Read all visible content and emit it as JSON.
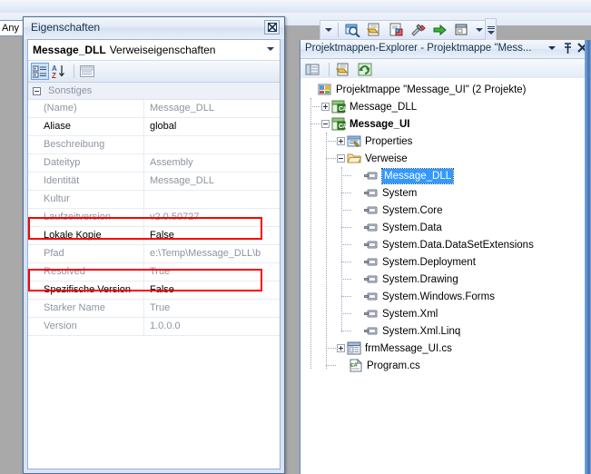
{
  "background": {
    "platform_combo_value": "Any",
    "toolbar_icons": [
      "search-folder-icon",
      "document-icon",
      "property-pages-icon",
      "tools-hammer-icon",
      "green-arrow-icon",
      "window-icon"
    ]
  },
  "properties_window": {
    "title": "Eigenschaften",
    "close_label": "Close",
    "object_name": "Message_DLL",
    "object_kind": "Verweiseigenschaften",
    "toolbar": {
      "categorized_label": "Kategorisiert",
      "alphabetical_label": "Alphabetisch",
      "property_pages_label": "Eigenschaftenseiten"
    },
    "category": "Sonstiges",
    "rows": [
      {
        "key": "(Name)",
        "value": "Message_DLL",
        "state": "readonly"
      },
      {
        "key": "Aliase",
        "value": "global",
        "state": "editable"
      },
      {
        "key": "Beschreibung",
        "value": "",
        "state": "readonly"
      },
      {
        "key": "Dateityp",
        "value": "Assembly",
        "state": "readonly"
      },
      {
        "key": "Identität",
        "value": "Message_DLL",
        "state": "readonly"
      },
      {
        "key": "Kultur",
        "value": "",
        "state": "readonly"
      },
      {
        "key": "Laufzeitversion",
        "value": "v2.0.50727",
        "state": "readonly"
      },
      {
        "key": "Lokale Kopie",
        "value": "False",
        "state": "highlighted"
      },
      {
        "key": "Pfad",
        "value": "e:\\Temp\\Message_DLL\\b",
        "state": "readonly"
      },
      {
        "key": "Resolved",
        "value": "True",
        "state": "readonly"
      },
      {
        "key": "Spezifische Version",
        "value": "False",
        "state": "highlighted"
      },
      {
        "key": "Starker Name",
        "value": "True",
        "state": "readonly"
      },
      {
        "key": "Version",
        "value": "1.0.0.0",
        "state": "readonly"
      }
    ],
    "annotation_color": "#ff0000"
  },
  "solution_explorer": {
    "title": "Projektmappen-Explorer - Projektmappe \"Mess...",
    "titlebar_buttons": [
      "chevron-down-icon",
      "pin-icon",
      "close-icon"
    ],
    "toolbar_buttons": [
      "properties-icon",
      "show-all-files-icon",
      "refresh-icon"
    ],
    "tree": [
      {
        "label": "Projektmappe \"Message_UI\" (2 Projekte)",
        "depth": 0,
        "expander": "none",
        "icon": "solution-icon",
        "style": "normal",
        "selected": false
      },
      {
        "label": "Message_DLL",
        "depth": 1,
        "expander": "plus",
        "icon": "csharp-project-icon",
        "style": "normal",
        "selected": false
      },
      {
        "label": "Message_UI",
        "depth": 1,
        "expander": "minus",
        "icon": "csharp-project-icon",
        "style": "bold",
        "selected": false
      },
      {
        "label": "Properties",
        "depth": 2,
        "expander": "plus",
        "icon": "properties-folder-icon",
        "style": "normal",
        "selected": false
      },
      {
        "label": "Verweise",
        "depth": 2,
        "expander": "minus",
        "icon": "folder-icon",
        "style": "normal",
        "selected": false
      },
      {
        "label": "Message_DLL",
        "depth": 3,
        "expander": "none",
        "icon": "reference-icon",
        "style": "normal",
        "selected": true
      },
      {
        "label": "System",
        "depth": 3,
        "expander": "none",
        "icon": "reference-icon",
        "style": "normal",
        "selected": false
      },
      {
        "label": "System.Core",
        "depth": 3,
        "expander": "none",
        "icon": "reference-icon",
        "style": "normal",
        "selected": false
      },
      {
        "label": "System.Data",
        "depth": 3,
        "expander": "none",
        "icon": "reference-icon",
        "style": "normal",
        "selected": false
      },
      {
        "label": "System.Data.DataSetExtensions",
        "depth": 3,
        "expander": "none",
        "icon": "reference-icon",
        "style": "normal",
        "selected": false
      },
      {
        "label": "System.Deployment",
        "depth": 3,
        "expander": "none",
        "icon": "reference-icon",
        "style": "normal",
        "selected": false
      },
      {
        "label": "System.Drawing",
        "depth": 3,
        "expander": "none",
        "icon": "reference-icon",
        "style": "normal",
        "selected": false
      },
      {
        "label": "System.Windows.Forms",
        "depth": 3,
        "expander": "none",
        "icon": "reference-icon",
        "style": "normal",
        "selected": false
      },
      {
        "label": "System.Xml",
        "depth": 3,
        "expander": "none",
        "icon": "reference-icon",
        "style": "normal",
        "selected": false
      },
      {
        "label": "System.Xml.Linq",
        "depth": 3,
        "expander": "none",
        "icon": "reference-icon",
        "style": "normal",
        "selected": false
      },
      {
        "label": "frmMessage_UI.cs",
        "depth": 2,
        "expander": "plus",
        "icon": "form-icon",
        "style": "normal",
        "selected": false
      },
      {
        "label": "Program.cs",
        "depth": 2,
        "expander": "none",
        "icon": "csharp-file-icon",
        "style": "normal",
        "selected": false
      }
    ]
  }
}
